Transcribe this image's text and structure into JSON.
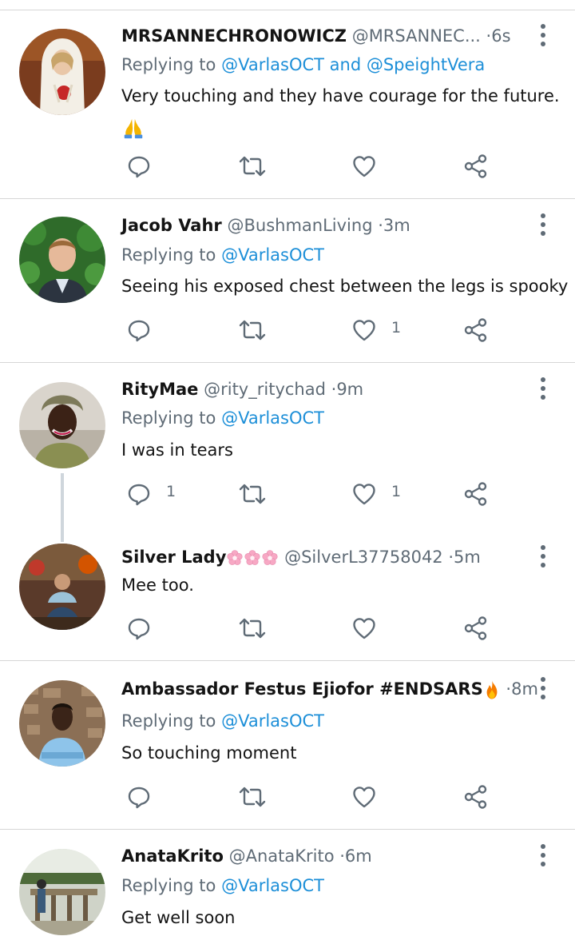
{
  "tweets": [
    {
      "name": "MRSANNECHRONOWICZ",
      "handle": "@MRSANNEC...",
      "time": "6s",
      "replying_prefix": "Replying to",
      "replying_to": "@VarlasOCT and @SpeightVera",
      "text": "Very touching and they have courage for the future.",
      "text_line2": "🙏",
      "reply_count": "",
      "retweet_count": "",
      "like_count": ""
    },
    {
      "name": "Jacob Vahr",
      "handle": "@BushmanLiving",
      "time": "3m",
      "replying_prefix": "Replying to",
      "replying_to": "@VarlasOCT",
      "text": "Seeing his exposed chest between the legs is spooky",
      "reply_count": "",
      "retweet_count": "",
      "like_count": "1"
    },
    {
      "name": "RityMae",
      "handle": "@rity_ritychad",
      "time": "9m",
      "replying_prefix": "Replying to",
      "replying_to": "@VarlasOCT",
      "text": "I was in tears",
      "reply_count": "1",
      "retweet_count": "",
      "like_count": "1"
    },
    {
      "name": "Silver Lady",
      "handle": "@SilverL37758042",
      "time": "5m",
      "text": "Mee too.",
      "reply_count": "",
      "retweet_count": "",
      "like_count": ""
    },
    {
      "name": "Ambassador Festus Ejiofor #ENDSARS",
      "time": "8m",
      "replying_prefix": "Replying to",
      "replying_to": "@VarlasOCT",
      "text": "So touching moment",
      "reply_count": "",
      "retweet_count": "",
      "like_count": ""
    },
    {
      "name": "AnataKrito",
      "handle": "@AnataKrito",
      "time": "6m",
      "replying_prefix": "Replying to",
      "replying_to": "@VarlasOCT",
      "text": "Get well soon"
    }
  ],
  "separator": "·",
  "icons": {
    "reply": "reply-icon",
    "retweet": "retweet-icon",
    "like": "heart-icon",
    "share": "share-icon",
    "more": "more-vertical-icon"
  },
  "colors": {
    "link": "#1d8fd8",
    "muted": "#5f6b76",
    "text": "#141414",
    "divider": "#d6d6d6"
  }
}
